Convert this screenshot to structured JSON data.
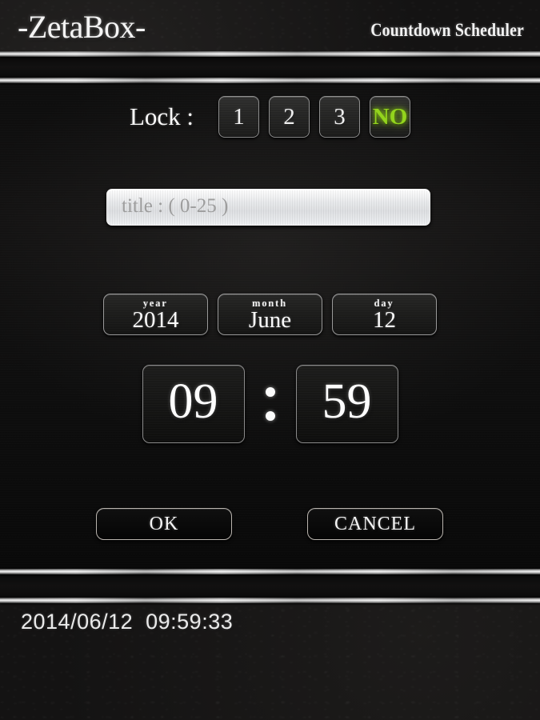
{
  "header": {
    "brand": "-ZetaBox-",
    "subtitle": "Countdown Scheduler"
  },
  "lock": {
    "label": "Lock :",
    "options": [
      {
        "label": "1",
        "selected": false
      },
      {
        "label": "2",
        "selected": false
      },
      {
        "label": "3",
        "selected": false
      },
      {
        "label": "NO",
        "selected": true
      }
    ],
    "selected_value": "NO",
    "selected_color": "#93d41d"
  },
  "title_field": {
    "value": "",
    "placeholder": "title : ( 0-25 )"
  },
  "date": {
    "year": {
      "caption": "year",
      "value": "2014"
    },
    "month": {
      "caption": "month",
      "value": "June"
    },
    "day": {
      "caption": "day",
      "value": "12"
    }
  },
  "time": {
    "hour": "09",
    "minute": "59",
    "separator": ":"
  },
  "actions": {
    "ok_label": "OK",
    "cancel_label": "CANCEL"
  },
  "statusbar": {
    "datetime": "2014/06/12  09:59:33",
    "date_part": "2014/06/12",
    "time_part": "09:59:33"
  }
}
